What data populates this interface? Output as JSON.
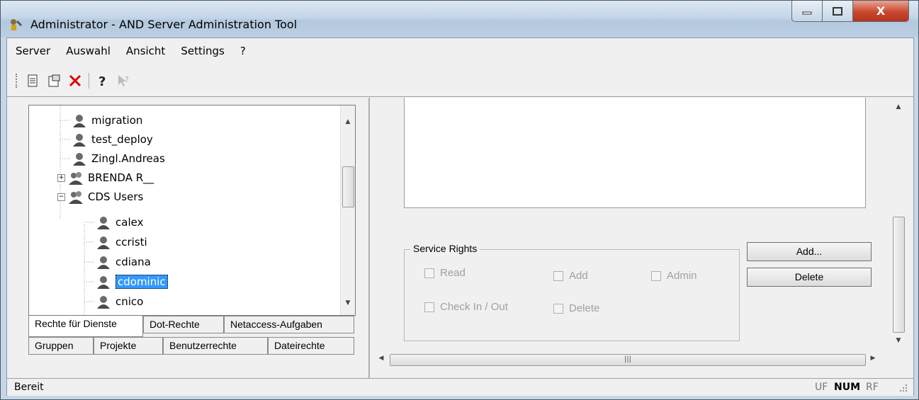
{
  "window": {
    "title": "Administrator - AND Server Administration Tool",
    "close_glyph": "X",
    "min_glyph": "—",
    "max_glyph": "□"
  },
  "menu": [
    "Server",
    "Auswahl",
    "Ansicht",
    "Settings",
    "?"
  ],
  "toolbar": {
    "icons": [
      "new-document-icon",
      "properties-icon",
      "delete-icon",
      "help-icon",
      "context-help-icon"
    ]
  },
  "tree": {
    "items": [
      {
        "label": "migration",
        "level": 2,
        "type": "user"
      },
      {
        "label": "test_deploy",
        "level": 2,
        "type": "user"
      },
      {
        "label": "Zingl.Andreas",
        "level": 2,
        "type": "user"
      },
      {
        "label": "BRENDA R__",
        "level": 1,
        "type": "group",
        "expander": "+"
      },
      {
        "label": "CDS Users",
        "level": 1,
        "type": "group",
        "expander": "−"
      },
      {
        "label": "calex",
        "level": 2,
        "type": "user"
      },
      {
        "label": "ccristi",
        "level": 2,
        "type": "user"
      },
      {
        "label": "cdiana",
        "level": 2,
        "type": "user"
      },
      {
        "label": "cdominic",
        "level": 2,
        "type": "user",
        "selected": true
      },
      {
        "label": "cnico",
        "level": 2,
        "type": "user"
      }
    ]
  },
  "tabs": {
    "row1": [
      "Rechte für Dienste",
      "Dot-Rechte",
      "Netaccess-Aufgaben"
    ],
    "row2": [
      "Gruppen",
      "Projekte",
      "Benutzerrechte",
      "Dateirechte"
    ]
  },
  "service_rights": {
    "label": "Service Rights",
    "read": "Read",
    "add": "Add",
    "admin": "Admin",
    "checkinout": "Check In / Out",
    "delete": "Delete"
  },
  "buttons": {
    "add": "Add...",
    "delete": "Delete"
  },
  "status": {
    "text": "Bereit",
    "uf": "UF",
    "num": "NUM",
    "rf": "RF"
  }
}
